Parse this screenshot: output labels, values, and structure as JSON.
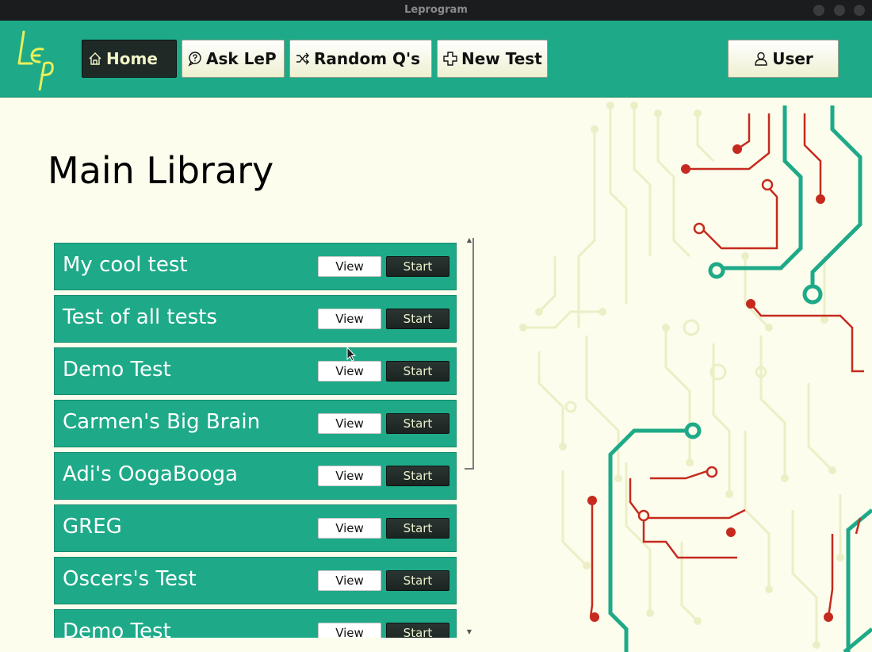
{
  "window": {
    "title": "Leprogram"
  },
  "header": {
    "logo_text": "LeP",
    "nav": [
      {
        "label": "Home",
        "icon": "home-icon",
        "active": true
      },
      {
        "label": "Ask LeP",
        "icon": "question-bubble-icon",
        "active": false
      },
      {
        "label": "Random Q's",
        "icon": "shuffle-icon",
        "active": false
      },
      {
        "label": "New Test",
        "icon": "plus-icon",
        "active": false
      }
    ],
    "user_label": "User",
    "user_icon": "user-icon"
  },
  "main": {
    "title": "Main Library",
    "tests": [
      {
        "name": "My cool test",
        "view_label": "View",
        "start_label": "Start"
      },
      {
        "name": "Test of all tests",
        "view_label": "View",
        "start_label": "Start"
      },
      {
        "name": "Demo Test",
        "view_label": "View",
        "start_label": "Start"
      },
      {
        "name": "Carmen's Big Brain",
        "view_label": "View",
        "start_label": "Start"
      },
      {
        "name": "Adi's OogaBooga",
        "view_label": "View",
        "start_label": "Start"
      },
      {
        "name": "GREG",
        "view_label": "View",
        "start_label": "Start"
      },
      {
        "name": "Oscers's Test",
        "view_label": "View",
        "start_label": "Start"
      },
      {
        "name": "Demo Test",
        "view_label": "View",
        "start_label": "Start"
      }
    ]
  },
  "colors": {
    "accent": "#1eaa88",
    "background": "#fcfdec",
    "dark_button": "#1f2a27",
    "circuit_red": "#c62a1f",
    "circuit_teal": "#1eaa88",
    "circuit_pale": "#ecefc6"
  }
}
